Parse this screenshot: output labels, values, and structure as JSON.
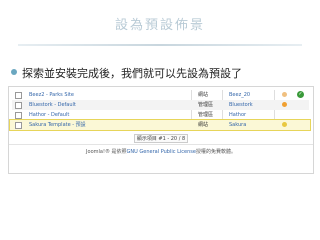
{
  "slide": {
    "title": "設為預設佈景",
    "bullet": "探索並安裝完成後，我們就可以先設為預設了"
  },
  "table": {
    "rows": [
      {
        "name": "Beez2 - Parks Site",
        "pos": "網站",
        "template": "Beez_20",
        "mark": "default"
      },
      {
        "name": "Bluestork - Default",
        "pos": "管理區",
        "template": "Bluestork",
        "mark": "orange"
      },
      {
        "name": "Hathor - Default",
        "pos": "管理區",
        "template": "Hathor",
        "mark": "none"
      },
      {
        "name": "Sakura Template - 預設",
        "pos": "網站",
        "template": "Sakura",
        "mark": "yellow"
      }
    ]
  },
  "pager": {
    "text": "顯示項目 #1 - 20 / 8"
  },
  "footer": {
    "prefix": "Joomla!® 是依照",
    "link": "GNU General Public License",
    "suffix": "授權的免費軟體。"
  },
  "colors": {
    "link": "#3366aa",
    "highlight_border": "#e7d55a",
    "highlight_bg": "#fbf8d6",
    "default_check": "#3a9a3a",
    "mark_orange": "#f0a030",
    "mark_yellow": "#e8c840"
  }
}
